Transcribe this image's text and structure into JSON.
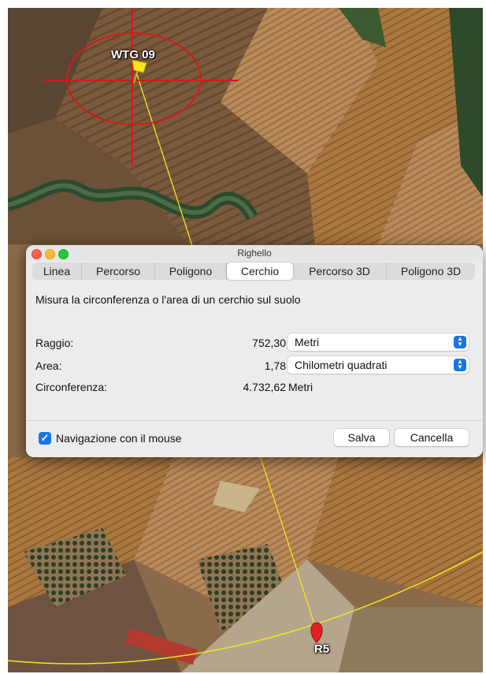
{
  "map": {
    "marker_top_label": "WTG 09",
    "marker_bottom_label": "R5",
    "colors": {
      "circle": "#d41a1a",
      "line": "#f2e51d",
      "pin": "#f8e31a"
    }
  },
  "window": {
    "title": "Righello",
    "tabs": [
      {
        "label": "Linea"
      },
      {
        "label": "Percorso"
      },
      {
        "label": "Poligono"
      },
      {
        "label": "Cerchio",
        "active": true
      },
      {
        "label": "Percorso 3D"
      },
      {
        "label": "Poligono 3D"
      }
    ],
    "description": "Misura la circonferenza o l'area di un cerchio sul suolo",
    "radius": {
      "label": "Raggio:",
      "value": "752,30",
      "unit": "Metri"
    },
    "area": {
      "label": "Area:",
      "value": "1,78",
      "unit": "Chilometri quadrati"
    },
    "circumference": {
      "label": "Circonferenza:",
      "value": "4.732,62",
      "unit": "Metri"
    },
    "navigation": {
      "label": "Navigazione con il mouse",
      "checked": true
    },
    "save_label": "Salva",
    "cancel_label": "Cancella",
    "accent_color": "#1a73e8"
  }
}
